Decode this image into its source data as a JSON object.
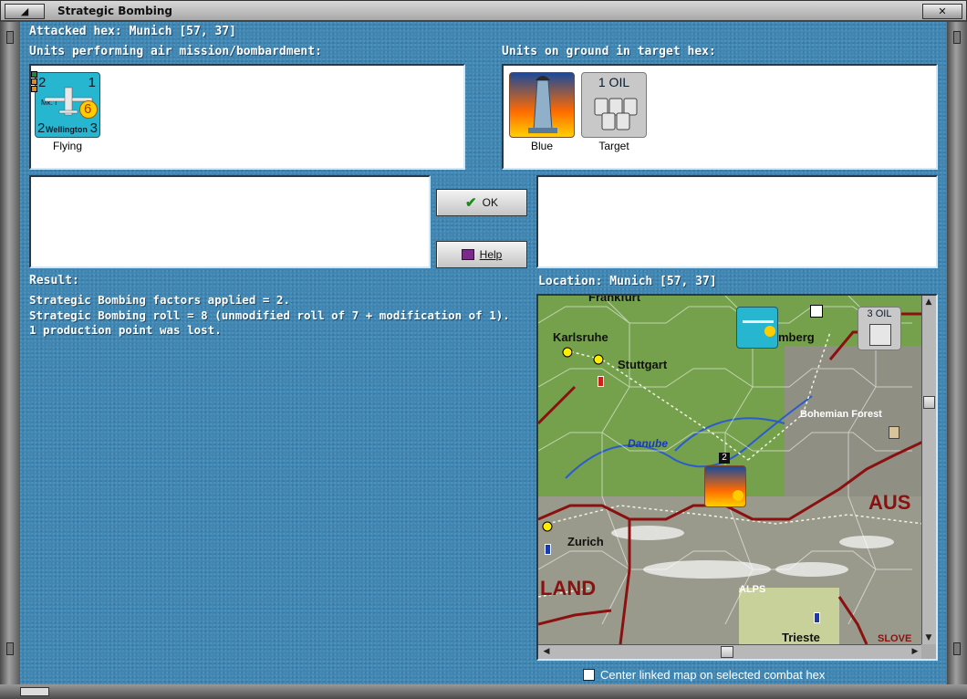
{
  "window": {
    "title": "Strategic Bombing"
  },
  "header": {
    "attacked_hex": "Attacked hex: Munich  [57, 37]"
  },
  "air_panel": {
    "label": "Units performing air mission/bombardment:",
    "units": [
      {
        "name": "Wellington",
        "mark": "Mk. I",
        "values": [
          "2",
          "1",
          "6",
          "2",
          "3"
        ],
        "caption": "Flying"
      }
    ]
  },
  "ground_panel": {
    "label": "Units on ground in target hex:",
    "units": [
      {
        "caption": "Blue"
      },
      {
        "top": "1 OIL",
        "caption": "Target"
      }
    ]
  },
  "buttons": {
    "ok": "OK",
    "help": "Help"
  },
  "result": {
    "label": "Result:",
    "lines": [
      "Strategic Bombing factors applied = 2.",
      "Strategic Bombing roll = 8 (unmodified roll of 7 + modification of 1).",
      "1 production point was lost."
    ]
  },
  "location": {
    "label": "Location:  Munich  [57, 37]",
    "map_labels": {
      "frankfurt": "Frankfurt",
      "karlsruhe": "Karlsruhe",
      "stuttgart": "Stuttgart",
      "nurnberg": "mberg",
      "bohemian": "Bohemian Forest",
      "danube": "Danube",
      "zurich": "Zurich",
      "aus": "AUS",
      "land": "LAND",
      "alps": "ALPS",
      "trieste": "Trieste",
      "slove": "SLOVE",
      "oil_counter": "3 OIL",
      "stack": "2"
    }
  },
  "center_checkbox": {
    "label": "Center linked map on selected combat hex",
    "checked": false
  },
  "colors": {
    "background": "#3e86b3",
    "counter": "#27b6cf",
    "border_red": "#8b1010"
  }
}
